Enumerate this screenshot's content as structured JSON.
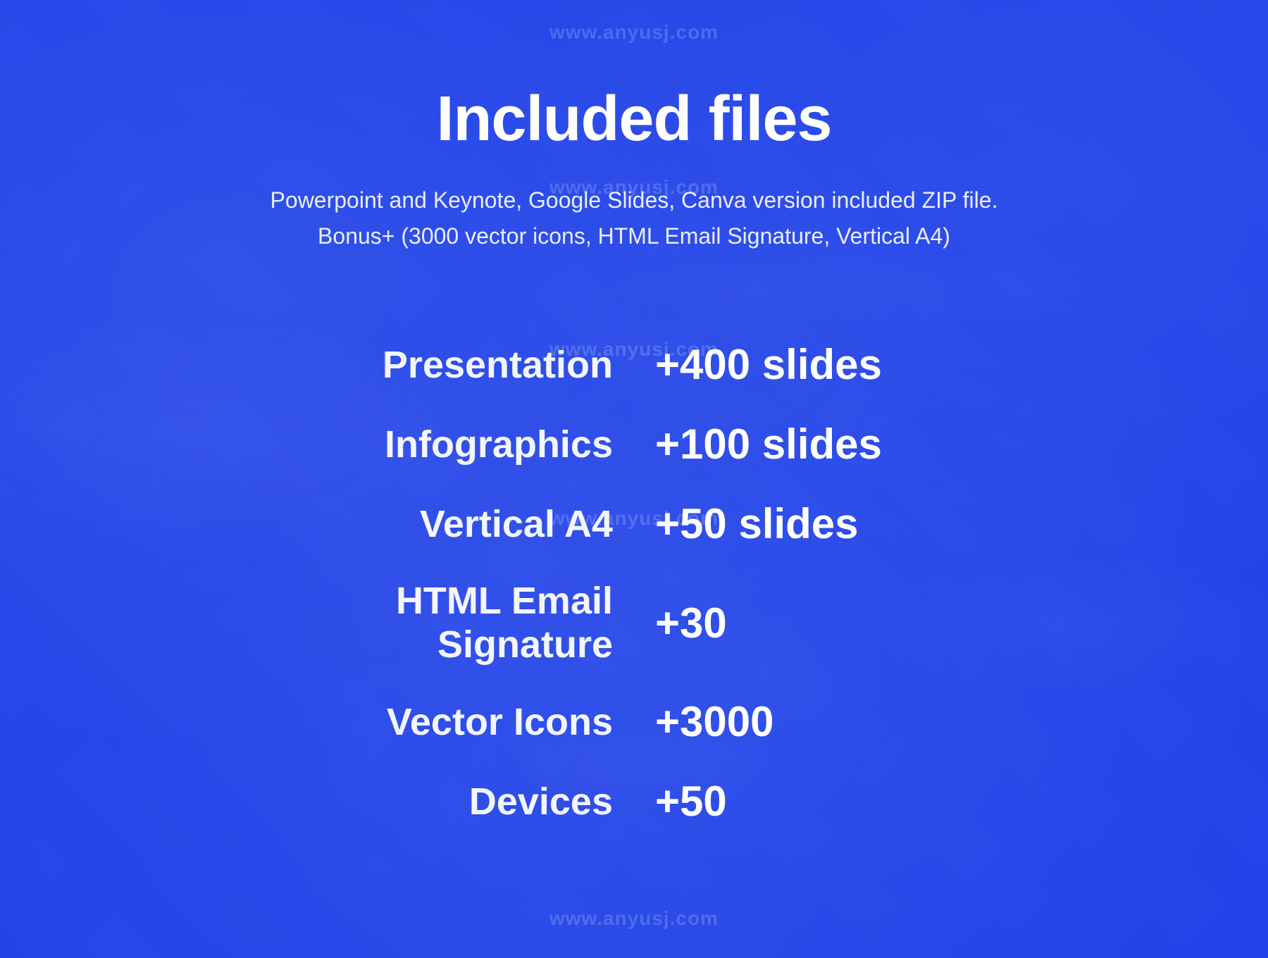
{
  "page": {
    "background_color": "#2244e8",
    "title": "Included files",
    "subtitle_line1": "Powerpoint and Keynote, Google Slides, Canva version included ZIP file.",
    "subtitle_line2": "Bonus+ (3000 vector icons, HTML Email Signature, Vertical A4)",
    "watermark_text": "www.anyusj.com",
    "items": [
      {
        "label": "Presentation",
        "value": "+400 slides"
      },
      {
        "label": "Infographics",
        "value": "+100 slides"
      },
      {
        "label": "Vertical A4",
        "value": "+50 slides"
      },
      {
        "label": "HTML Email Signature",
        "value": "+30"
      },
      {
        "label": "Vector Icons",
        "value": "+3000"
      },
      {
        "label": "Devices",
        "value": "+50"
      }
    ]
  }
}
